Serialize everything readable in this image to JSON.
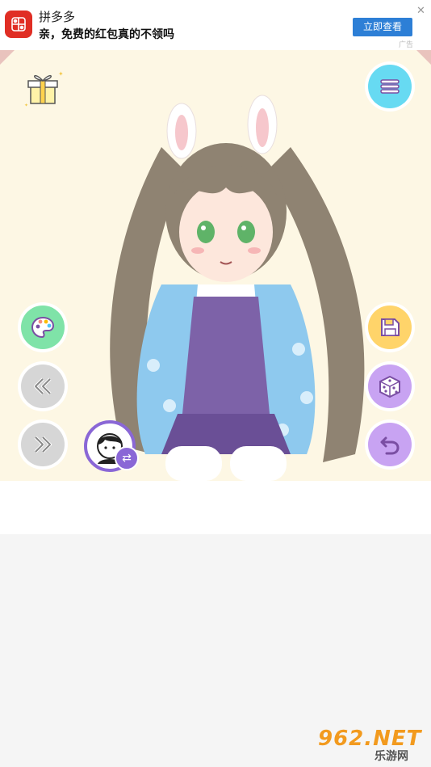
{
  "ad": {
    "app_name": "拼多多",
    "tagline": "亲，免费的红包真的不领吗",
    "cta_label": "立即查看",
    "close_glyph": "✕",
    "ad_tag": "广告",
    "brand_color": "#e02e24",
    "cta_color": "#2d7fd6"
  },
  "game": {
    "background_color": "#fdf7e4",
    "buttons_left": [
      {
        "name": "palette-button",
        "icon": "palette-icon",
        "color": "#7fe3a8"
      },
      {
        "name": "previous-button",
        "icon": "double-chevron-left-icon",
        "color": "#d6d6d6"
      },
      {
        "name": "next-button",
        "icon": "double-chevron-right-icon",
        "color": "#d6d6d6"
      }
    ],
    "buttons_right": [
      {
        "name": "menu-button",
        "icon": "hamburger-menu-icon",
        "color": "#67daf2"
      },
      {
        "name": "save-button",
        "icon": "floppy-disk-icon",
        "color": "#ffd46a"
      },
      {
        "name": "randomize-button",
        "icon": "dice-icon",
        "color": "#c8a3f2"
      },
      {
        "name": "undo-button",
        "icon": "undo-icon",
        "color": "#c8a3f2"
      }
    ],
    "avatar_swap_glyph": "⇄"
  },
  "watermark": {
    "top": "962.NET",
    "bottom": "乐游网"
  }
}
